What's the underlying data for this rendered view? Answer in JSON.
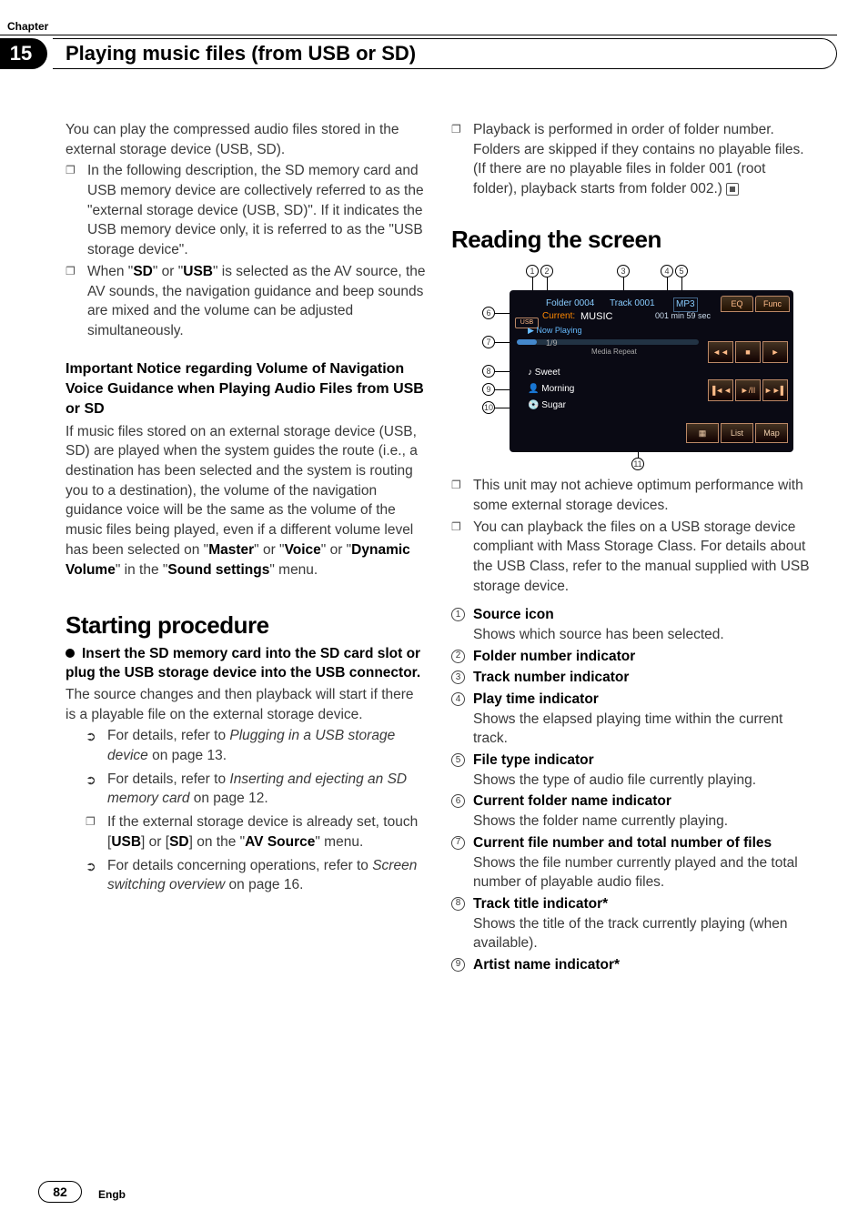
{
  "chapter": {
    "label": "Chapter",
    "number": "15",
    "title": "Playing music files (from USB or SD)"
  },
  "left": {
    "intro": "You can play the compressed audio files stored in the external storage device (USB, SD).",
    "bullets": [
      "In the following description, the SD memory card and USB memory device are collectively referred to as the \"external storage device (USB, SD)\". If it indicates the USB memory device only, it is referred to as the \"USB storage device\".",
      "When \"SD\" or \"USB\" is selected as the AV source, the AV sounds, the navigation guidance and beep sounds are mixed and the volume can be adjusted simultaneously."
    ],
    "sd_label": "SD",
    "usb_label": "USB",
    "notice_heading": "Important Notice regarding Volume of Navigation Voice Guidance when Playing Audio Files from USB or SD",
    "notice_body_1": "If music files stored on an external storage device (USB, SD) are played when the system guides the route (i.e., a destination has been selected and the system is routing you to a destination), the volume of the navigation guidance voice will be the same as the volume of the music files being played, even if a different volume level has been selected on \"",
    "master": "Master",
    "or1": "\" or \"",
    "voice": "Voice",
    "or2": "\" or \"",
    "dynamic": "Dynamic Volume",
    "in_the": "\" in the \"",
    "sound_settings": "Sound settings",
    "menu_end": "\" menu.",
    "starting_heading": "Starting procedure",
    "step_lead": "Insert the SD memory card into the SD card slot or plug the USB storage device into the USB connector.",
    "step_body": "The source changes and then playback will start if there is a playable file on the external storage device.",
    "refs": [
      {
        "type": "refer",
        "pre": "For details, refer to ",
        "ital": "Plugging in a USB storage device",
        "post": " on page 13."
      },
      {
        "type": "refer",
        "pre": "For details, refer to ",
        "ital": "Inserting and ejecting an SD memory card",
        "post": " on page 12."
      },
      {
        "type": "box",
        "text_pre": "If the external storage device is already set, touch [",
        "b1": "USB",
        "mid": "] or [",
        "b2": "SD",
        "post": "] on the \"",
        "b3": "AV Source",
        "end": "\" menu."
      },
      {
        "type": "refer",
        "pre": "For details concerning operations, refer to ",
        "ital": "Screen switching overview",
        "post": " on page 16."
      }
    ]
  },
  "right": {
    "top_bullet": "Playback is performed in order of folder number. Folders are skipped if they contains no playable files. (If there are no playable files in folder 001 (root folder), playback starts from folder 002.)",
    "reading_heading": "Reading the screen",
    "shot": {
      "usb": "USB",
      "folder": "Folder 0004",
      "track": "Track 0001",
      "mp3": "MP3",
      "eq": "EQ",
      "func": "Func",
      "current_label": "Current:",
      "current_val": "MUSIC",
      "time": "001 min 59 sec",
      "now_playing": "Now Playing",
      "progress": "1/9",
      "media_repeat": "Media Repeat",
      "row_track": "Sweet",
      "row_artist": "Morning",
      "row_album": "Sugar",
      "prev": "◄◄",
      "stop": "■",
      "next": "►",
      "skip_back": "▐◄◄",
      "play_pause": "►/II",
      "skip_fwd": "►►▌",
      "grid": "▦",
      "list": "List",
      "map": "Map"
    },
    "post_bullets": [
      "This unit may not achieve optimum performance with some external storage devices.",
      "You can playback the files on a USB storage device compliant with Mass Storage Class. For details about the USB Class, refer to the manual supplied with USB storage device."
    ],
    "items": [
      {
        "n": "1",
        "title": "Source icon",
        "desc": "Shows which source has been selected."
      },
      {
        "n": "2",
        "title": "Folder number indicator",
        "desc": ""
      },
      {
        "n": "3",
        "title": "Track number indicator",
        "desc": ""
      },
      {
        "n": "4",
        "title": "Play time indicator",
        "desc": "Shows the elapsed playing time within the current track."
      },
      {
        "n": "5",
        "title": "File type indicator",
        "desc": "Shows the type of audio file currently playing."
      },
      {
        "n": "6",
        "title": "Current folder name indicator",
        "desc": "Shows the folder name currently playing."
      },
      {
        "n": "7",
        "title": "Current file number and total number of files",
        "desc": "Shows the file number currently played and the total number of playable audio files."
      },
      {
        "n": "8",
        "title": "Track title indicator*",
        "desc": "Shows the title of the track currently playing (when available)."
      },
      {
        "n": "9",
        "title": "Artist name indicator*",
        "desc": ""
      }
    ]
  },
  "footer": {
    "page": "82",
    "lang": "Engb"
  }
}
